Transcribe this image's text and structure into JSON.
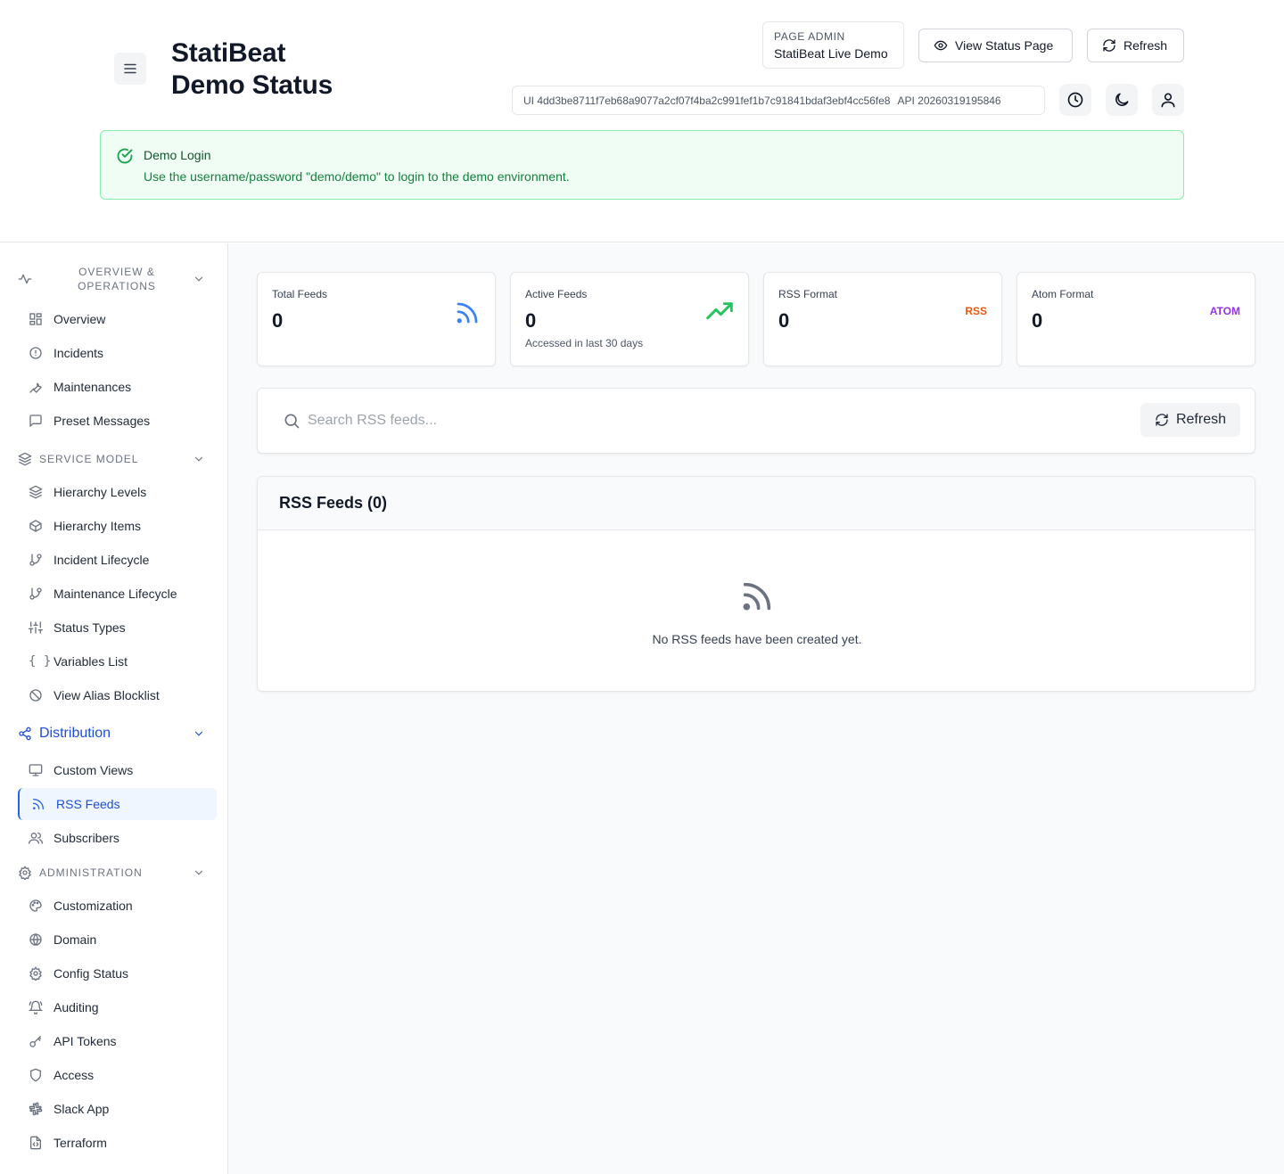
{
  "header": {
    "title_line1": "StatiBeat",
    "title_line2": "Demo Status",
    "page_admin_label": "PAGE ADMIN",
    "page_admin_value": "StatiBeat Live Demo",
    "view_status_label": "View Status Page",
    "refresh_label": "Refresh",
    "ui_version": "UI 4dd3be8711f7eb68a9077a2cf07f4ba2c991fef1b7c91841bdaf3ebf4cc56fe8",
    "api_version": "API 20260319195846"
  },
  "alert": {
    "title": "Demo Login",
    "message": "Use the username/password \"demo/demo\" to login to the demo environment."
  },
  "sidebar": {
    "sections": [
      {
        "label": "OVERVIEW &",
        "label2": "OPERATIONS",
        "icon": "activity-icon"
      },
      {
        "label": "SERVICE MODEL",
        "icon": "layers-icon"
      },
      {
        "label": "Distribution",
        "icon": "share-icon"
      },
      {
        "label": "ADMINISTRATION",
        "icon": "settings-icon"
      }
    ],
    "items": [
      {
        "label": "Overview"
      },
      {
        "label": "Incidents"
      },
      {
        "label": "Maintenances"
      },
      {
        "label": "Preset Messages"
      },
      {
        "label": "Hierarchy Levels"
      },
      {
        "label": "Hierarchy Items"
      },
      {
        "label": "Incident Lifecycle"
      },
      {
        "label": "Maintenance Lifecycle"
      },
      {
        "label": "Status Types"
      },
      {
        "label": "Variables List"
      },
      {
        "label": "View Alias Blocklist"
      },
      {
        "label": "Custom Views"
      },
      {
        "label": "RSS Feeds"
      },
      {
        "label": "Subscribers"
      },
      {
        "label": "Customization"
      },
      {
        "label": "Domain"
      },
      {
        "label": "Config Status"
      },
      {
        "label": "Auditing"
      },
      {
        "label": "API Tokens"
      },
      {
        "label": "Access"
      },
      {
        "label": "Slack App"
      },
      {
        "label": "Terraform"
      }
    ]
  },
  "stats": [
    {
      "label": "Total Feeds",
      "value": "0",
      "sub": ""
    },
    {
      "label": "Active Feeds",
      "value": "0",
      "sub": "Accessed in last 30 days"
    },
    {
      "label": "RSS Format",
      "value": "0",
      "tag": "RSS"
    },
    {
      "label": "Atom Format",
      "value": "0",
      "tag": "ATOM"
    }
  ],
  "search": {
    "placeholder": "Search RSS feeds...",
    "refresh_label": "Refresh"
  },
  "feeds": {
    "title": "RSS Feeds (0)",
    "empty_message": "No RSS feeds have been created yet."
  },
  "colors": {
    "accent": "#2563eb",
    "rss_tag": "#ea580c",
    "atom_tag": "#9333ea",
    "trend": "#16a34a",
    "alert_bg": "#f0fdf4"
  }
}
